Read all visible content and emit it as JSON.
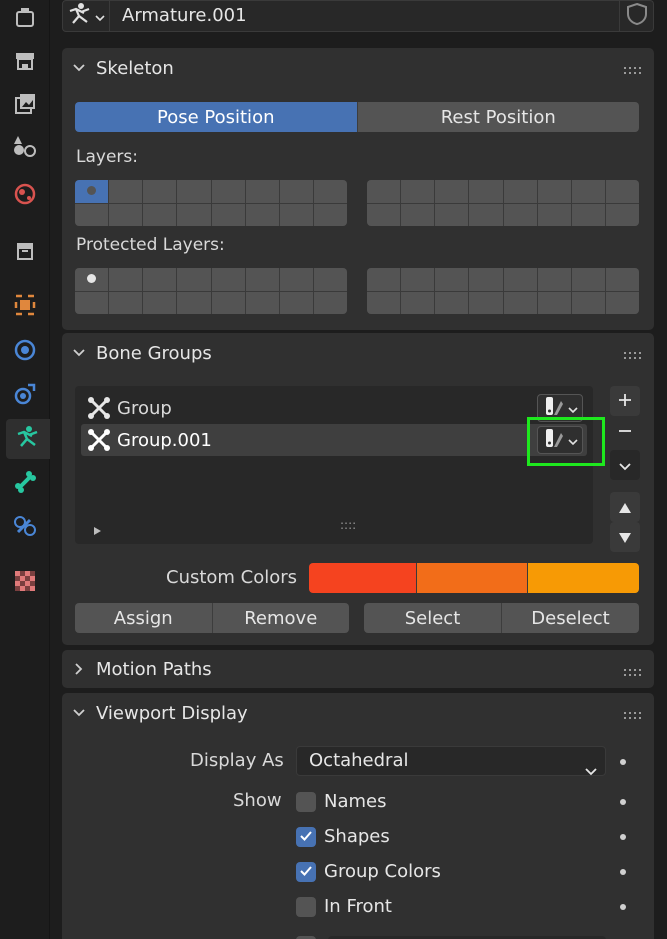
{
  "header": {
    "object_name": "Armature.001"
  },
  "tabs": [
    {
      "icon": "tool-icon"
    },
    {
      "icon": "render-icon"
    },
    {
      "icon": "output-icon"
    },
    {
      "icon": "view-layer-icon"
    },
    {
      "icon": "scene-icon"
    },
    {
      "icon": "world-icon"
    },
    {
      "icon": "collection-icon"
    },
    {
      "icon": "object-icon"
    },
    {
      "icon": "modifier-icon"
    },
    {
      "icon": "physics-icon"
    },
    {
      "icon": "armature-data-icon"
    },
    {
      "icon": "bone-icon"
    },
    {
      "icon": "bone-constraint-icon"
    },
    {
      "icon": "texture-icon"
    }
  ],
  "skeleton": {
    "title": "Skeleton",
    "pose_label": "Pose Position",
    "rest_label": "Rest Position",
    "layers_label": "Layers:",
    "protected_label": "Protected Layers:"
  },
  "bone_groups": {
    "title": "Bone Groups",
    "items": [
      {
        "name": "Group"
      },
      {
        "name": "Group.001"
      }
    ],
    "selected_index": 1,
    "custom_colors_label": "Custom Colors",
    "colors": [
      "#f5431f",
      "#f26d19",
      "#f79a05"
    ],
    "assign_label": "Assign",
    "remove_label": "Remove",
    "select_label": "Select",
    "deselect_label": "Deselect",
    "grip_text": "::::"
  },
  "motion_paths": {
    "title": "Motion Paths"
  },
  "viewport_display": {
    "title": "Viewport Display",
    "display_as_label": "Display As",
    "display_as_value": "Octahedral",
    "show_label": "Show",
    "names_label": "Names",
    "names_checked": false,
    "shapes_label": "Shapes",
    "shapes_checked": true,
    "group_colors_label": "Group Colors",
    "group_colors_checked": true,
    "in_front_label": "In Front",
    "in_front_checked": false
  },
  "accent": "#4772b3",
  "highlight_color": "#1ee81e"
}
